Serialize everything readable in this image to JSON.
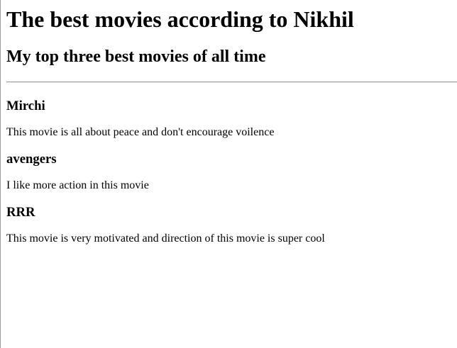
{
  "page": {
    "title": "The best movies according to Nikhil",
    "subtitle": "My top three best movies of all time"
  },
  "movies": [
    {
      "name": "Mirchi",
      "description": "This movie is all about peace and don't encourage voilence"
    },
    {
      "name": "avengers",
      "description": "I like more action in this movie"
    },
    {
      "name": "RRR",
      "description": "This movie is very motivated and direction of this movie is super cool"
    }
  ]
}
